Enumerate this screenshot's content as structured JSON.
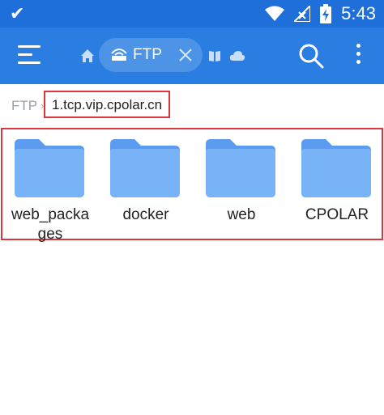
{
  "status_bar": {
    "time": "5:43",
    "icons": [
      "download-done-icon",
      "wifi-icon",
      "signal-icon",
      "battery-charging-icon"
    ]
  },
  "app_bar": {
    "menu_icon": "hamburger-menu-icon",
    "home_icon": "home-icon",
    "active_tab": {
      "label": "FTP",
      "icon": "ftp-icon",
      "close_icon": "close-icon"
    },
    "other_tabs": [
      "book-icon",
      "cloud-icon"
    ],
    "search_icon": "search-icon",
    "more_icon": "more-vert-icon"
  },
  "breadcrumb": {
    "root": "FTP",
    "separator": "›",
    "current": "1.tcp.vip.cpolar.cn"
  },
  "folders": [
    {
      "name": "web_packa\nges"
    },
    {
      "name": "docker"
    },
    {
      "name": "web"
    },
    {
      "name": "CPOLAR"
    }
  ],
  "colors": {
    "status_bar": "#1e6fd9",
    "app_bar": "#2a7de1",
    "tab_active": "#4d93e6",
    "folder": "#6aa8f5",
    "highlight_border": "#d9363e"
  }
}
